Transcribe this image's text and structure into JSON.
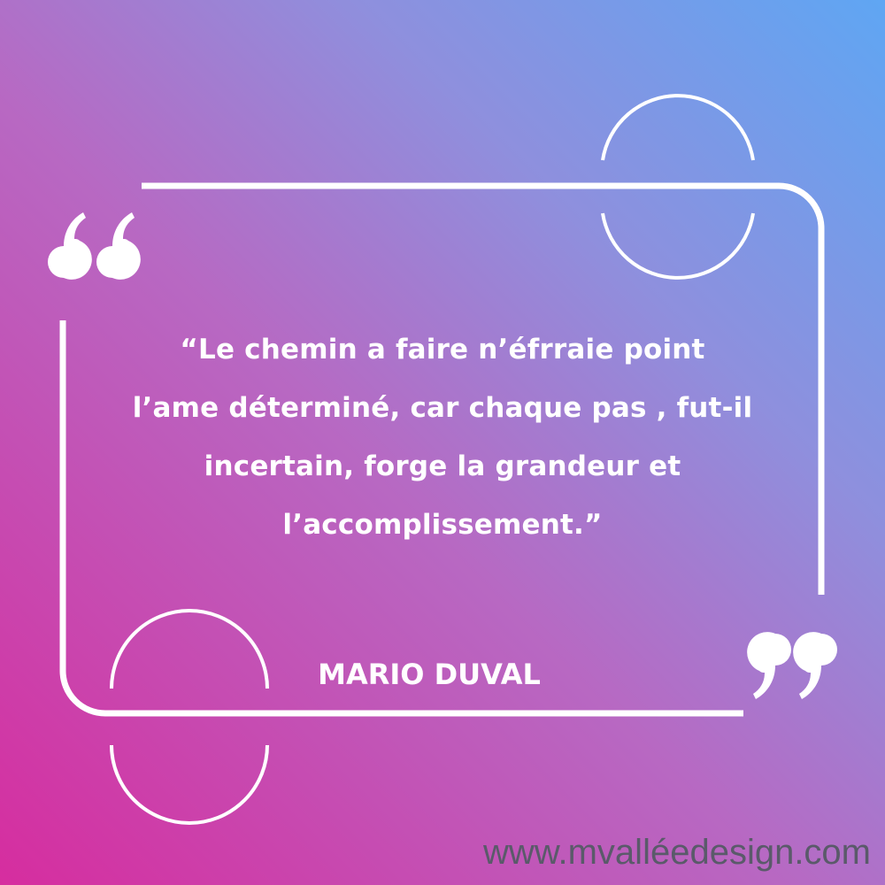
{
  "quote": {
    "lines": [
      "“Le chemin a faire n’éfrraie point",
      "l’ame déterminé, car chaque pas , fut-il",
      "incertain, forge la grandeur et",
      "l’accomplissement.”"
    ]
  },
  "author": "MARIO DUVAL",
  "website": "www.mvalléedesign.com",
  "icons": {
    "open_quote": "open-quote-mark-icon",
    "close_quote": "close-quote-mark-icon"
  },
  "colors": {
    "gradient_pink": "#d62d9f",
    "gradient_blue": "#5fa6f3",
    "foreground": "#ffffff",
    "website_text": "#5a5a6a"
  }
}
